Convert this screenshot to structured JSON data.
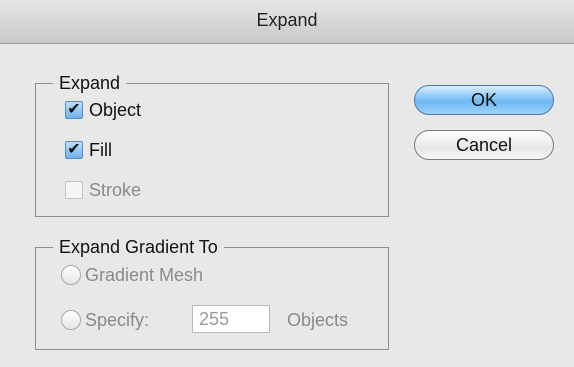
{
  "window": {
    "title": "Expand"
  },
  "expand_group": {
    "legend": "Expand",
    "object": {
      "label": "Object",
      "checked": true
    },
    "fill": {
      "label": "Fill",
      "checked": true
    },
    "stroke": {
      "label": "Stroke",
      "checked": false,
      "enabled": false
    }
  },
  "gradient_group": {
    "legend": "Expand Gradient To",
    "gradient_mesh": {
      "label": "Gradient Mesh",
      "selected": false,
      "enabled": false
    },
    "specify": {
      "label": "Specify:",
      "selected": false,
      "enabled": false,
      "value": "255",
      "units": "Objects"
    }
  },
  "buttons": {
    "ok": "OK",
    "cancel": "Cancel"
  },
  "icons": {
    "checkmark": "✔"
  },
  "colors": {
    "accent": "#6fb7f2",
    "disabled_text": "#8a8a8a"
  }
}
